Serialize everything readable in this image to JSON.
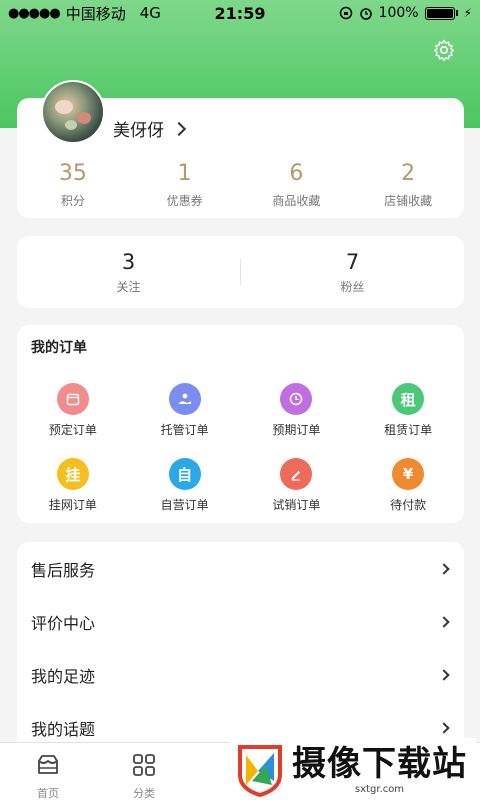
{
  "status_bar": {
    "signal_dots": "●●●●●",
    "carrier": "中国移动",
    "network": "4G",
    "time": "21:59",
    "battery_percent": "100%"
  },
  "profile": {
    "username": "美伢伢",
    "stats": [
      {
        "value": "35",
        "label": "积分"
      },
      {
        "value": "1",
        "label": "优惠券"
      },
      {
        "value": "6",
        "label": "商品收藏"
      },
      {
        "value": "2",
        "label": "店铺收藏"
      }
    ]
  },
  "follow": [
    {
      "value": "3",
      "label": "关注"
    },
    {
      "value": "7",
      "label": "粉丝"
    }
  ],
  "orders": {
    "title": "我的订单",
    "items": [
      {
        "label": "预定订单",
        "icon": "calendar-icon",
        "color": "#f08c8c",
        "glyph": ""
      },
      {
        "label": "托管订单",
        "icon": "hand-person-icon",
        "color": "#7b8ef0",
        "glyph": ""
      },
      {
        "label": "预期订单",
        "icon": "clock-icon",
        "color": "#c06ee0",
        "glyph": ""
      },
      {
        "label": "租赁订单",
        "icon": "rent-icon",
        "color": "#4cc87a",
        "glyph": "租"
      },
      {
        "label": "挂网订单",
        "icon": "hang-icon",
        "color": "#f4c020",
        "glyph": "挂"
      },
      {
        "label": "自营订单",
        "icon": "self-icon",
        "color": "#2aa8e8",
        "glyph": "自"
      },
      {
        "label": "试销订单",
        "icon": "pen-icon",
        "color": "#ee6a5a",
        "glyph": ""
      },
      {
        "label": "待付款",
        "icon": "yen-icon",
        "color": "#f08a30",
        "glyph": "¥"
      }
    ]
  },
  "menu": [
    {
      "label": "售后服务"
    },
    {
      "label": "评价中心"
    },
    {
      "label": "我的足迹"
    },
    {
      "label": "我的话题"
    }
  ],
  "tabbar": [
    {
      "label": "首页",
      "icon": "home-icon"
    },
    {
      "label": "分类",
      "icon": "grid-icon"
    }
  ],
  "watermark": {
    "title": "摄像下载站",
    "url": "sxtgr.com"
  }
}
